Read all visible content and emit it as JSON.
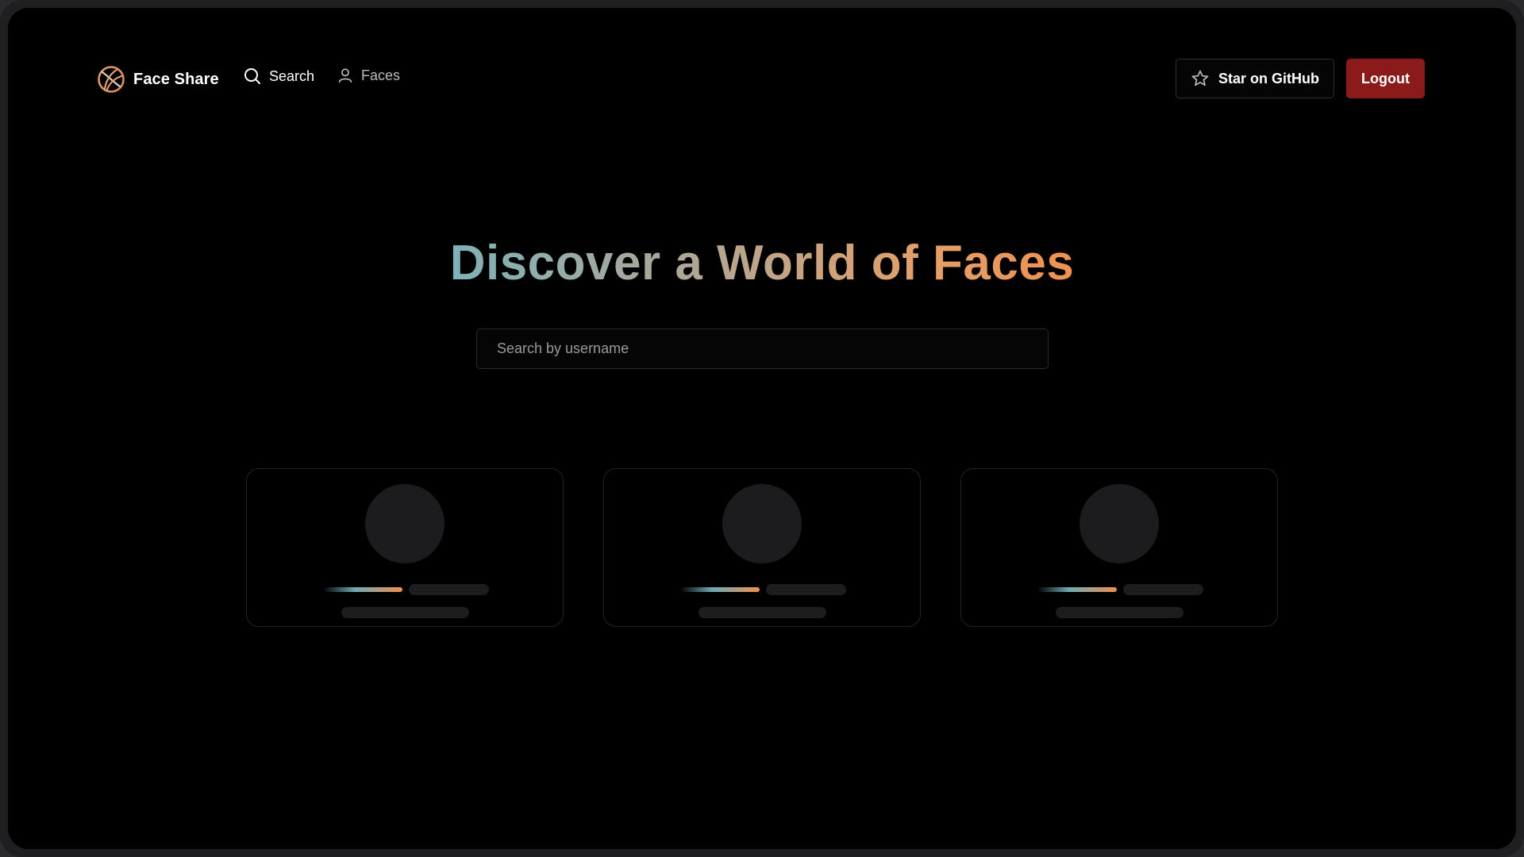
{
  "nav": {
    "brand_name": "Face Share",
    "brand_icon": "globe-logo-icon",
    "search_label": "Search",
    "search_icon": "search-icon",
    "faces_label": "Faces",
    "faces_icon": "user-icon"
  },
  "header_actions": {
    "github_label": "Star on GitHub",
    "github_icon": "star-icon",
    "logout_label": "Logout"
  },
  "hero": {
    "title": "Discover a World of Faces"
  },
  "search": {
    "placeholder": "Search by username",
    "value": ""
  },
  "cards": [
    {
      "state": "loading-skeleton"
    },
    {
      "state": "loading-skeleton"
    },
    {
      "state": "loading-skeleton"
    }
  ],
  "colors": {
    "background": "#000000",
    "logout_button": "#8b1b1b",
    "gradient_start": "#7fb1b9",
    "gradient_end": "#ef9250",
    "skeleton": "#1d1d1f"
  }
}
